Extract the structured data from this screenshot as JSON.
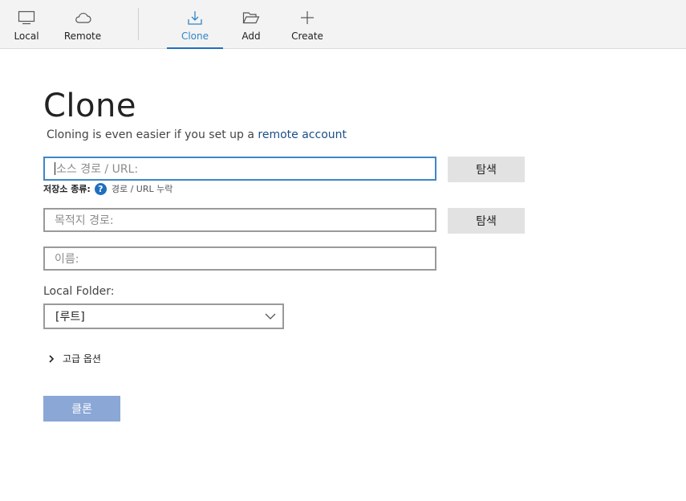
{
  "toolbar": {
    "items": [
      {
        "label": "Local",
        "icon": "monitor-icon"
      },
      {
        "label": "Remote",
        "icon": "cloud-icon"
      },
      {
        "label": "Clone",
        "icon": "download-icon",
        "active": true
      },
      {
        "label": "Add",
        "icon": "folder-open-icon"
      },
      {
        "label": "Create",
        "icon": "plus-icon"
      }
    ]
  },
  "page": {
    "title": "Clone",
    "subtitle_prefix": "Cloning is even easier if you set up a ",
    "subtitle_link": "remote account"
  },
  "form": {
    "source_placeholder": "소스 경로 / URL:",
    "browse_label": "탐색",
    "repo_type_label": "저장소 종류:",
    "repo_type_value": "경로 / URL 누락",
    "destination_placeholder": "목적지 경로:",
    "name_placeholder": "이름:",
    "local_folder_label": "Local Folder:",
    "local_folder_value": "[루트]",
    "advanced_label": "고급 옵션",
    "clone_button": "클론"
  },
  "colors": {
    "accent": "#1f6fbf",
    "active_tab_text": "#2e86c9",
    "focused_border": "#3c87c8",
    "clone_button_bg": "#8aa7d6",
    "link": "#1a4f86"
  }
}
